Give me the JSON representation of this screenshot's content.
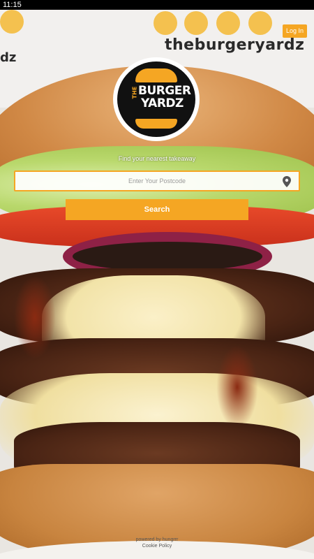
{
  "status_bar": {
    "time": "11:15"
  },
  "background": {
    "wall_text": "theburgeryardz",
    "wall_text_left": "dz"
  },
  "header": {
    "login_label": "Log In"
  },
  "logo": {
    "the": "THE",
    "line1": "BURGER",
    "line2": "YARDZ"
  },
  "search": {
    "hint": "Find your nearest takeaway",
    "placeholder": "Enter Your Postcode",
    "value": "",
    "button_label": "Search"
  },
  "footer": {
    "powered_by": "powered by hungrrr",
    "sub": "Cookie Policy"
  },
  "colors": {
    "accent": "#f5a623",
    "background": "#000000"
  },
  "icons": {
    "location": "location-pin-icon"
  }
}
